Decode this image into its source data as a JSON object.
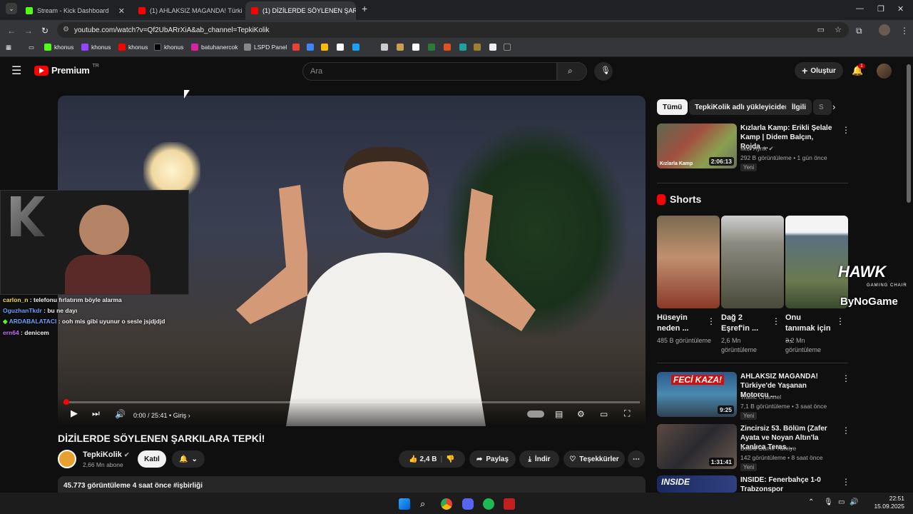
{
  "browser": {
    "tabs": [
      {
        "label": "Stream - Kick Dashboard",
        "color": "#53fc18"
      },
      {
        "label": "(1) AHLAKSIZ MAGANDA! Türki",
        "color": "#ff0000"
      },
      {
        "label": "(1) DİZİLERDE SÖYLENEN ŞARK",
        "color": "#ff0000"
      }
    ],
    "url": "youtube.com/watch?v=Qf2UbARrXiA&ab_channel=TepkiKolik",
    "bookmarks": [
      "khonus",
      "khonus",
      "khonus",
      "khonus",
      "batuhanercok",
      "LSPD Panel"
    ]
  },
  "youtube": {
    "logo": "Premium",
    "region": "TR",
    "search_placeholder": "Ara",
    "create_label": "Oluştur",
    "notif_count": "1"
  },
  "video": {
    "time": "0:00 / 25:41",
    "chapter": "Giriş",
    "title": "DİZİLERDE SÖYLENEN ŞARKILARA TEPKİ!",
    "channel": "TepkiKolik",
    "subscribers": "2,66 Mn abone",
    "join": "Katıl",
    "likes": "2,4 B",
    "share": "Paylaş",
    "download": "İndir",
    "thanks": "Teşekkürler",
    "description": "45.773 görüntüleme  4 saat önce  #işbirliği"
  },
  "overlay": {
    "chat": [
      {
        "user": "carlon_n",
        "color": "#f0e040",
        "msg": "telefonu fırlatırım böyle alarma"
      },
      {
        "user": "OguzhanTkdr",
        "color": "#6aa0ff",
        "msg": "bu ne dayı"
      },
      {
        "user": "ARDABALATACI",
        "color": "#6aa0ff",
        "msg": "ooh mis gibi uyunur o sesle jsjdjdjd"
      },
      {
        "user": "ern64",
        "color": "#c070ff",
        "msg": "denicem"
      }
    ],
    "sponsor_1": "HAWK",
    "sponsor_1_sub": "GAMING CHAIR",
    "sponsor_2": "ByNoGame"
  },
  "filters": [
    "Tümü",
    "TepkiKolik adlı yükleyiciden",
    "İlgili",
    "S"
  ],
  "related_top": {
    "title": "Kızlarla Kamp: Erikli Şelale Kamp | Didem Balçın, Rojda ...",
    "channel": "İlker Ayrık",
    "meta": "292 B görüntüleme • 1 gün önce",
    "badge": "Yeni",
    "duration": "2:06:13",
    "thumb_text": "Kızlarla Kamp"
  },
  "shorts_header": "Shorts",
  "shorts": [
    {
      "title": "Hüseyin neden ...",
      "views": "485 B görüntüleme"
    },
    {
      "title": "Dağ 2 Eşref'in ...",
      "views": "2,6 Mn görüntüleme"
    },
    {
      "title": "Onu tanımak için ...",
      "views": "3,2 Mn görüntüleme"
    }
  ],
  "related": [
    {
      "title": "AHLAKSIZ MAGANDA! Türkiye'de Yaşanan Motorcu ...",
      "channel": "Traffic Channel",
      "meta": "7,1 B görüntüleme • 3 saat önce",
      "badge": "Yeni",
      "duration": "9:25",
      "thumb_text": "FECİ KAZA!"
    },
    {
      "title": "Zincirsiz 53. Bölüm (Zafer Ayata ve Noyan Altın'la Kanlıca Teras...",
      "channel": "Board Game Türkiye",
      "meta": "142 görüntüleme • 8 saat önce",
      "badge": "Yeni",
      "duration": "1:31:41"
    },
    {
      "title": "INSIDE: Fenerbahçe 1-0 Trabzonspor",
      "thumb_text": "INSIDE"
    }
  ],
  "taskbar": {
    "time": "22:51",
    "date": "15.09.2025"
  }
}
